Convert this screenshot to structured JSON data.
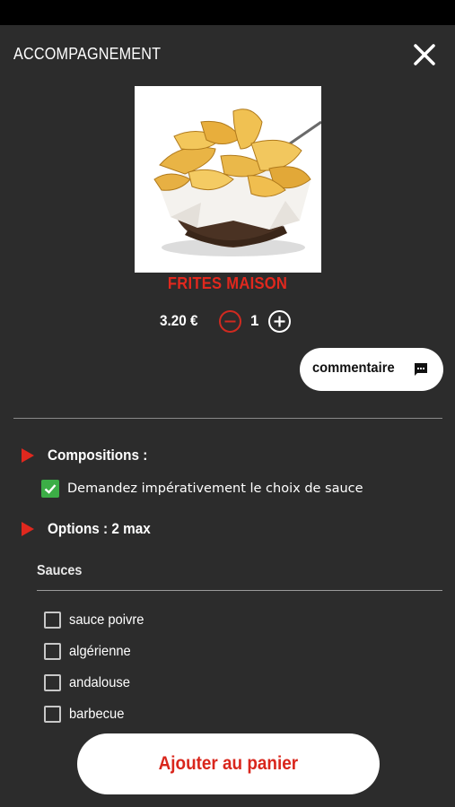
{
  "header": {
    "title": "ACCOMPAGNEMENT",
    "close_icon": "close-icon"
  },
  "product": {
    "name": "FRITES MAISON",
    "price": "3.20 €",
    "quantity": "1",
    "name_color": "#e0281e"
  },
  "comment": {
    "label": "commentaire",
    "icon": "comment-icon"
  },
  "compositions": {
    "heading": "Compositions :",
    "items": [
      {
        "label": "Demandez impérativement le choix de sauce",
        "checked": true
      }
    ]
  },
  "options": {
    "heading": "Options :  2 max",
    "group_title": "Sauces",
    "items": [
      {
        "label": " sauce poivre",
        "checked": false
      },
      {
        "label": "algérienne",
        "checked": false
      },
      {
        "label": "andalouse",
        "checked": false
      },
      {
        "label": "barbecue",
        "checked": false
      }
    ]
  },
  "cart": {
    "label": "Ajouter au panier"
  },
  "colors": {
    "background": "#2c2c2c",
    "accent": "#e0281e",
    "check": "#3cad46"
  }
}
